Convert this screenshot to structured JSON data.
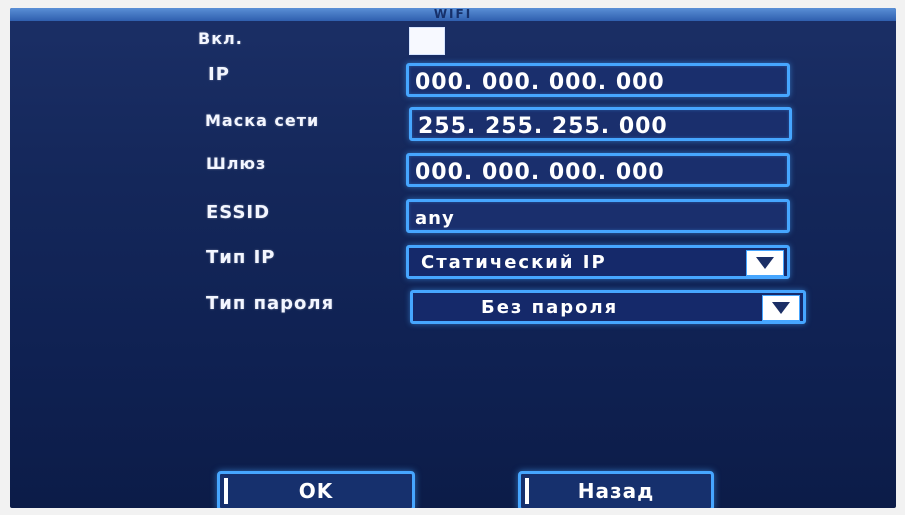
{
  "title": "WIFI",
  "labels": {
    "enable": "Вкл.",
    "ip": "IP",
    "mask": "Маска сети",
    "gateway": "Шлюз",
    "essid": "ESSID",
    "ip_type": "Тип IP",
    "password_type": "Тип пароля"
  },
  "fields": {
    "ip": "000. 000. 000. 000",
    "mask": "255. 255. 255. 000",
    "gateway": "000. 000. 000. 000",
    "essid": "any"
  },
  "selects": {
    "ip_type": "Статический IP",
    "password_type": "Без пароля"
  },
  "buttons": {
    "ok": "OK",
    "back": "Назад"
  },
  "colors": {
    "accent": "#46a6ff",
    "background": "#14275a"
  },
  "icons": {
    "dropdown": "chevron-down-icon"
  }
}
